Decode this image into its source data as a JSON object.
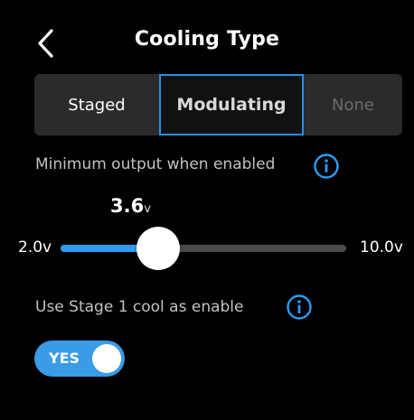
{
  "header": {
    "title": "Cooling Type"
  },
  "cooling_type": {
    "options": [
      "Staged",
      "Modulating",
      "None"
    ],
    "selected": "Modulating"
  },
  "min_output": {
    "label": "Minimum output when enabled",
    "value": "3.6",
    "value_unit": "v",
    "numeric_value": 3.6,
    "min_label": "2.0v",
    "max_label": "10.0v",
    "min": 2.0,
    "max": 10.0
  },
  "stage1": {
    "label": "Use Stage 1 cool as enable",
    "toggle_label": "YES",
    "on": true
  },
  "colors": {
    "accent": "#2e9bf0",
    "background": "#000000",
    "segment_bg": "#2b2b2b"
  },
  "icons": {
    "back": "chevron-left-icon",
    "info": "info-circle-icon"
  }
}
